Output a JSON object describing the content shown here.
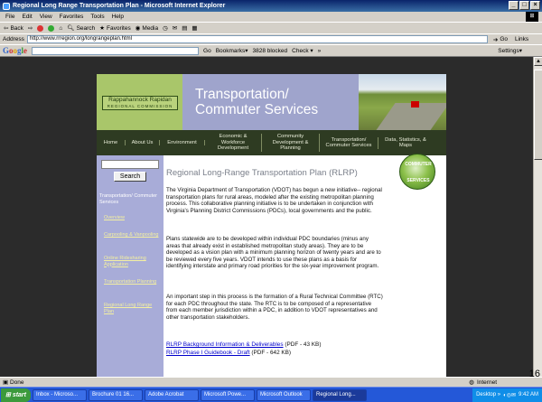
{
  "window": {
    "title": "Regional Long Range Transportation Plan - Microsoft Internet Explorer",
    "min": "_",
    "max": "□",
    "close": "×"
  },
  "menu": [
    "File",
    "Edit",
    "View",
    "Favorites",
    "Tools",
    "Help"
  ],
  "toolbar": {
    "back": "Back",
    "search": "Search",
    "favorites": "Favorites",
    "media": "Media"
  },
  "address": {
    "label": "Address",
    "url": "http://www.rrregion.org/longrangeplan.html",
    "go": "Go",
    "links": "Links"
  },
  "googlebar": {
    "logo": [
      "G",
      "o",
      "o",
      "g",
      "l",
      "e"
    ],
    "go": "Go",
    "bookmarks": "Bookmarks▾",
    "blocked": "3828 blocked",
    "check": "Check ▾",
    "more": "»",
    "settings": "Settings▾"
  },
  "site": {
    "logo_line1": "Rappahannock Rapidan",
    "logo_line2": "REGIONAL COMMISSION",
    "banner_title_1": "Transportation/",
    "banner_title_2": "Commuter Services",
    "nav": [
      "Home",
      "About Us",
      "Environment",
      "Economic & Workforce Development",
      "Community Development & Planning",
      "Transportation/ Commuter Services",
      "Data, Statistics, & Maps"
    ],
    "search_button": "Search",
    "side_heading": "Transportation/ Commuter Services",
    "side_links": [
      "Overview",
      "Carpooling & Vanpooling",
      "Online Ridesharing Application",
      "Transportation Planning",
      "Regional Long Range Plan"
    ],
    "badge_top": "COMMUTER",
    "badge_bottom": "SERVICES",
    "content_title": "Regional Long-Range Transportation Plan (RLRP)",
    "paragraphs": [
      "The Virginia Department of Transportation (VDOT) has begun a new initiative-- regional transportation plans for rural areas, modeled after the existing metropolitan planning process. This collaborative planning initiative is to be undertaken in conjunction with Virginia's Planning District Commissions (PDCs), local governments and the public.",
      "Plans statewide are to be developed within individual PDC boundaries (minus any areas that already exist in established metropolitan study areas). They are to be developed as a vision plan with a minimum planning horizon of twenty years and are to be reviewed every five years. VDOT intends to use these plans as a basis for identifying interstate and primary road priorities for the six-year improvement program.",
      "An important step in this process is the formation of a Rural Technical Committee (RTC) for each PDC throughout the state. The RTC is to be composed of a representative from each member jurisdiction within a PDC, in addition to VDOT representatives and other transportation stakeholders."
    ],
    "links": [
      {
        "text": "RLRP Background Information & Deliverables",
        "suffix": " (PDF - 43 KB)"
      },
      {
        "text": "RLRP Phase I Guidebook - Draft",
        "suffix": " (PDF - 642 KB)"
      }
    ]
  },
  "status": {
    "left": "Done",
    "zone": "Internet",
    "slide_number": "16"
  },
  "taskbar": {
    "start": "start",
    "tasks": [
      "Inbox - Microso...",
      "Brochure 01 16...",
      "Adobe Acrobat",
      "Microsoft Powe...",
      "Microsoft Outlook",
      "Regional Long..."
    ],
    "desktop": "Desktop »",
    "clock": "9:42 AM"
  }
}
